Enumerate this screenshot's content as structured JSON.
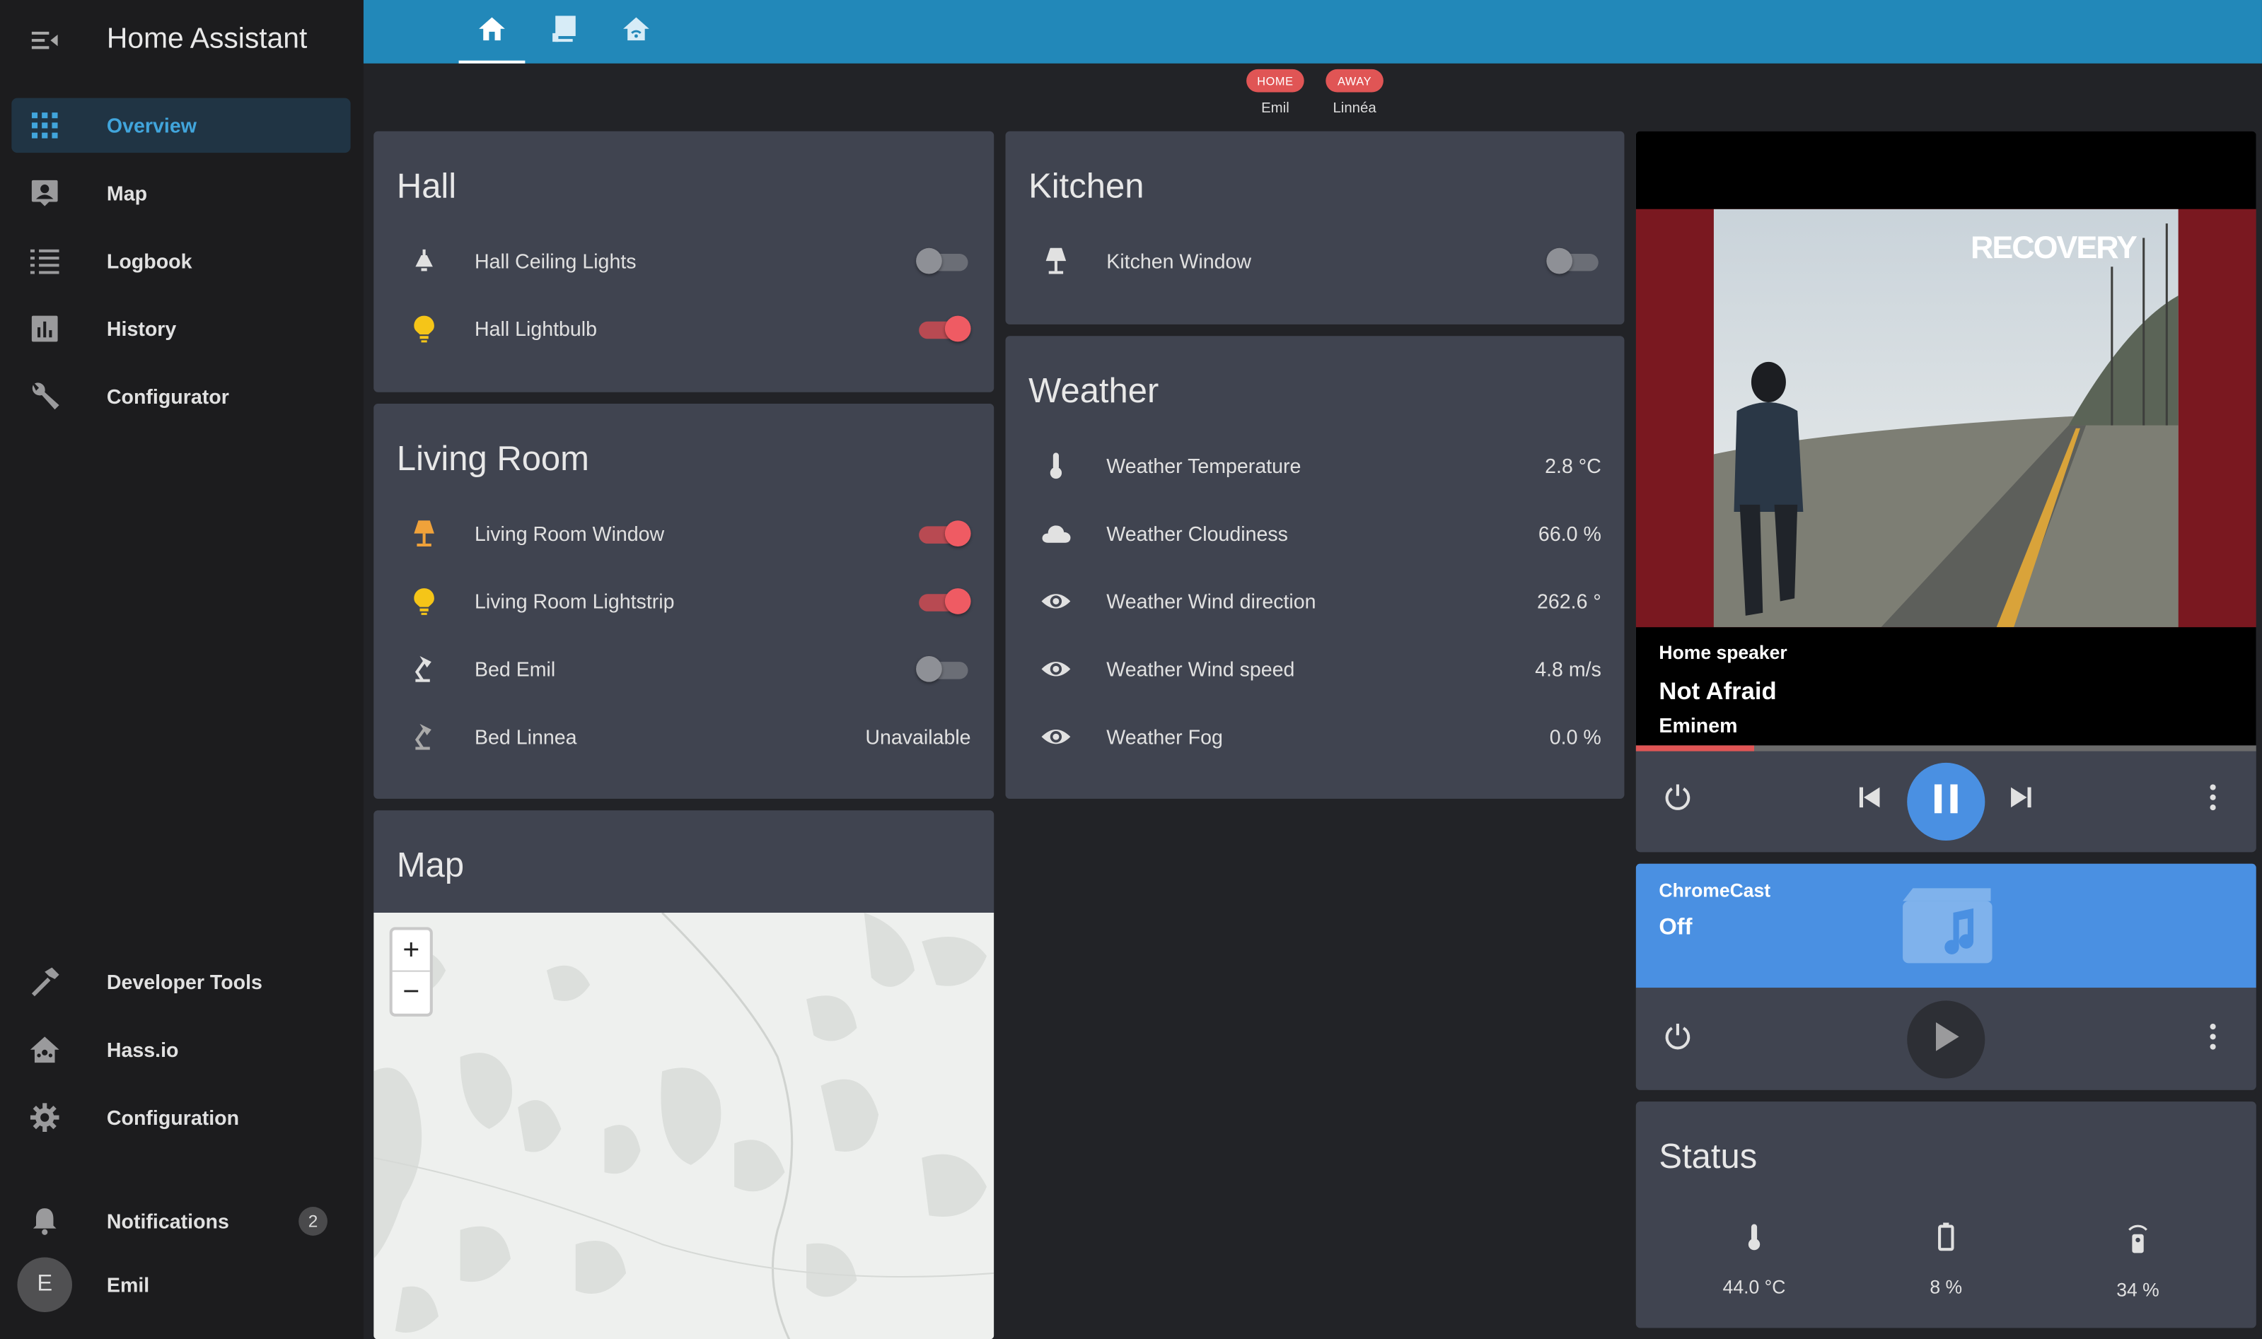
{
  "app": {
    "title": "Home Assistant"
  },
  "sidebar": {
    "items": [
      {
        "label": "Overview",
        "icon": "grid-icon"
      },
      {
        "label": "Map",
        "icon": "map-person-icon"
      },
      {
        "label": "Logbook",
        "icon": "list-icon"
      },
      {
        "label": "History",
        "icon": "chart-icon"
      },
      {
        "label": "Configurator",
        "icon": "wrench-icon"
      },
      {
        "label": "Developer Tools",
        "icon": "hammer-icon"
      },
      {
        "label": "Hass.io",
        "icon": "home-assistant-icon"
      },
      {
        "label": "Configuration",
        "icon": "gear-icon"
      },
      {
        "label": "Notifications",
        "icon": "bell-icon",
        "count": "2"
      }
    ],
    "user": {
      "initial": "E",
      "name": "Emil"
    }
  },
  "tabs": [
    {
      "icon": "home-icon"
    },
    {
      "icon": "book-icon"
    },
    {
      "icon": "house-signal-icon"
    }
  ],
  "persons": [
    {
      "state": "HOME",
      "name": "Emil"
    },
    {
      "state": "AWAY",
      "name": "Linnéa"
    }
  ],
  "hall": {
    "title": "Hall",
    "rows": [
      {
        "name": "Hall Ceiling Lights",
        "state": "off"
      },
      {
        "name": "Hall Lightbulb",
        "state": "on"
      }
    ]
  },
  "kitchen": {
    "title": "Kitchen",
    "rows": [
      {
        "name": "Kitchen Window",
        "state": "off"
      }
    ]
  },
  "living": {
    "title": "Living Room",
    "rows": [
      {
        "name": "Living Room Window",
        "state": "on"
      },
      {
        "name": "Living Room Lightstrip",
        "state": "on"
      },
      {
        "name": "Bed Emil",
        "state": "off"
      },
      {
        "name": "Bed Linnea",
        "value": "Unavailable"
      }
    ]
  },
  "weather": {
    "title": "Weather",
    "rows": [
      {
        "name": "Weather Temperature",
        "value": "2.8 °C"
      },
      {
        "name": "Weather Cloudiness",
        "value": "66.0 %"
      },
      {
        "name": "Weather Wind direction",
        "value": "262.6 °"
      },
      {
        "name": "Weather Wind speed",
        "value": "4.8 m/s"
      },
      {
        "name": "Weather Fog",
        "value": "0.0 %"
      }
    ]
  },
  "map": {
    "title": "Map",
    "zoom_in": "+",
    "zoom_out": "−"
  },
  "media": {
    "player": "Home speaker",
    "track": "Not Afraid",
    "artist": "Eminem",
    "cover_text": "RECOVERY",
    "progress": 0.19
  },
  "chromecast": {
    "name": "ChromeCast",
    "state": "Off"
  },
  "status": {
    "title": "Status",
    "items": [
      {
        "value": "44.0 °C",
        "icon": "thermometer-icon"
      },
      {
        "value": "8 %",
        "icon": "battery-icon"
      },
      {
        "value": "34 %",
        "icon": "remote-icon"
      }
    ]
  },
  "colors": {
    "accent": "#2288b9",
    "toggle_on": "#ef5b63",
    "chromecast": "#4a90e2"
  }
}
